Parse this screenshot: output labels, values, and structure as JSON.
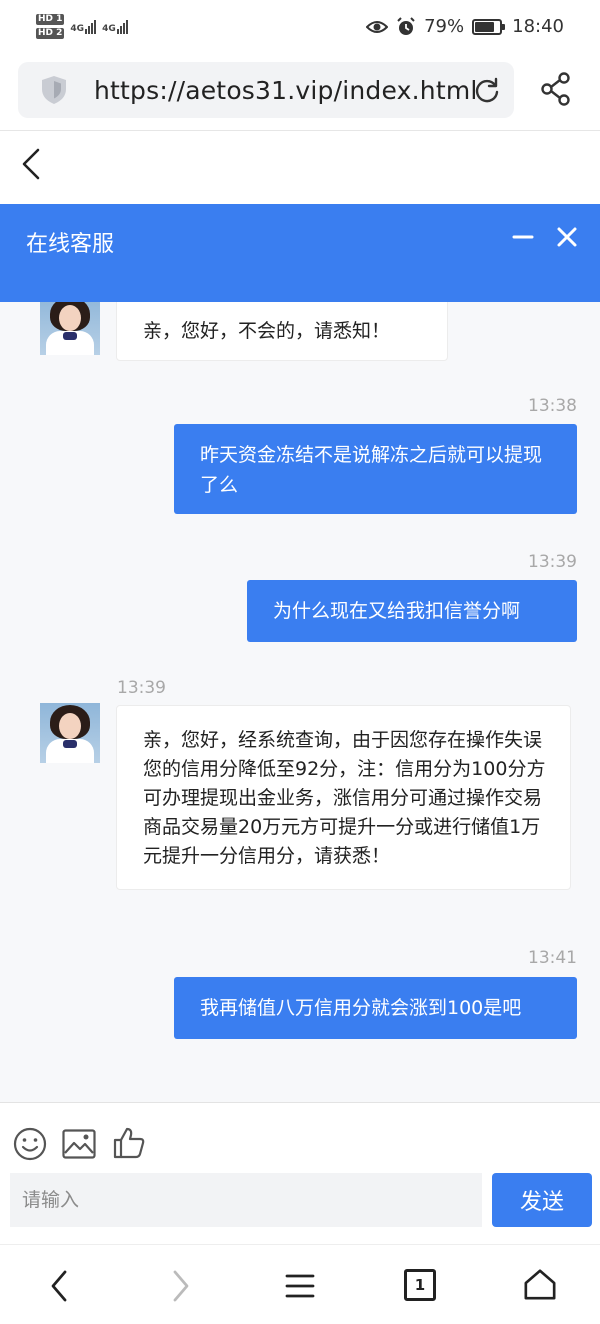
{
  "status_bar": {
    "sim1": "HD 1",
    "sim2": "HD 2",
    "network1": "4G",
    "network2": "4G",
    "battery_percent": "79%",
    "battery_level": 0.79,
    "time": "18:40",
    "icons": [
      "eye-icon",
      "alarm-icon",
      "battery-icon"
    ]
  },
  "browser": {
    "url": "https://aetos31.vip/index.html",
    "tab_count": "1",
    "icons": [
      "shield-icon",
      "reload-icon",
      "share-icon",
      "back-arrow-icon",
      "forward-arrow-icon",
      "menu-icon",
      "home-icon"
    ]
  },
  "chat": {
    "title": "在线客服",
    "messages": [
      {
        "from": "agent",
        "time": "",
        "text": "亲，您好，不会的，请悉知！"
      },
      {
        "from": "user",
        "time": "13:38",
        "text": "昨天资金冻结不是说解冻之后就可以提现了么"
      },
      {
        "from": "user",
        "time": "13:39",
        "text": "为什么现在又给我扣信誉分啊"
      },
      {
        "from": "agent",
        "time": "13:39",
        "text": "亲，您好，经系统查询，由于因您存在操作失误您的信用分降低至92分，注：信用分为100分方可办理提现出金业务，涨信用分可通过操作交易商品交易量20万元方可提升一分或进行储值1万元提升一分信用分，请获悉！"
      },
      {
        "from": "user",
        "time": "13:41",
        "text": "我再储值八万信用分就会涨到100是吧"
      }
    ],
    "input_placeholder": "请输入",
    "send_label": "发送",
    "tool_icons": [
      "emoji-icon",
      "image-icon",
      "thumbs-up-icon"
    ]
  }
}
